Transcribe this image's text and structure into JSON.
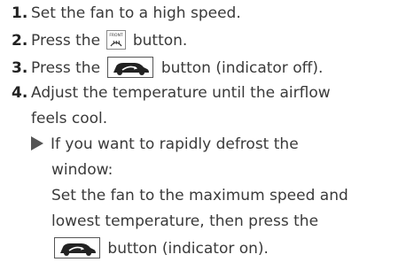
{
  "steps": [
    {
      "num": "1.",
      "text": "Set the fan to a high speed."
    },
    {
      "num": "2.",
      "before": "Press the",
      "after": "button.",
      "icon": "front-defrost-icon",
      "icon_text": "FRONT"
    },
    {
      "num": "3.",
      "before": "Press the",
      "after": "button (indicator off).",
      "icon": "recirculation-icon"
    },
    {
      "num": "4.",
      "text": "Adjust the temperature until the airflow",
      "continuation": "feels cool."
    }
  ],
  "note": {
    "line1": "If you want to rapidly defrost the",
    "line2": "window:",
    "line3": "Set the fan to the maximum speed and",
    "line4": "lowest temperature, then press the",
    "line5_after": "button (indicator on).",
    "icon": "recirculation-icon"
  }
}
